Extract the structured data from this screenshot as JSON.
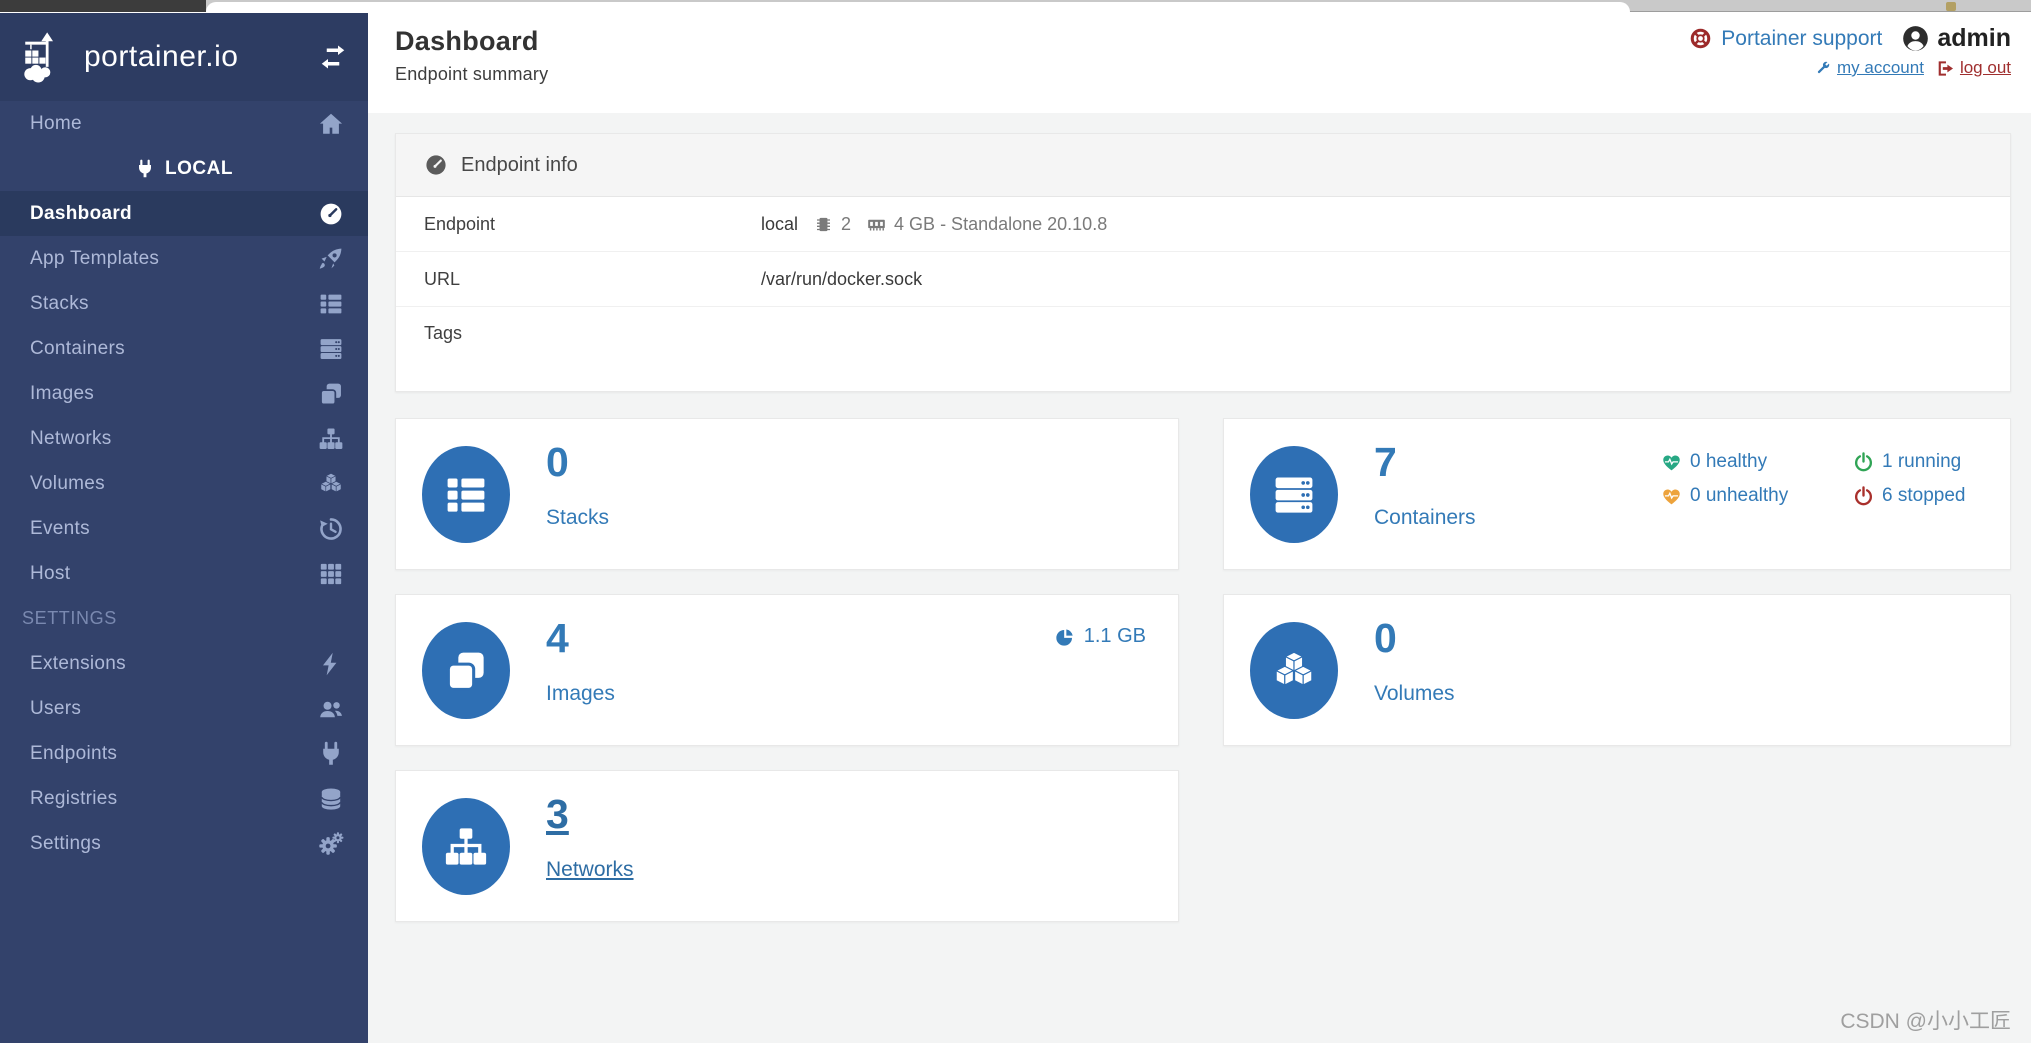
{
  "colors": {
    "accent_blue": "#337ab7",
    "badge_circle_blue": "#2e6fb4",
    "sidebar_bg": "#33426b",
    "sidebar_logo_bg": "#2d3c62",
    "sidebar_active_bg": "#2a3a5e",
    "healthy_green": "#27a884",
    "running_green": "#30a455",
    "unhealthy_orange": "#eda33c",
    "stopped_red": "#a9302c",
    "support_red": "#9c2a2a",
    "content_bg": "#f3f4f4"
  },
  "chrome": {
    "watermark": "CSDN @小小工匠"
  },
  "brand": {
    "name": "portainer.io"
  },
  "sidebar": {
    "home_label": "Home",
    "group_label": "LOCAL",
    "items": [
      {
        "label": "Dashboard",
        "icon": "gauge-icon",
        "active": true
      },
      {
        "label": "App Templates",
        "icon": "rocket-icon"
      },
      {
        "label": "Stacks",
        "icon": "list-icon"
      },
      {
        "label": "Containers",
        "icon": "server-icon"
      },
      {
        "label": "Images",
        "icon": "clone-icon"
      },
      {
        "label": "Networks",
        "icon": "sitemap-icon"
      },
      {
        "label": "Volumes",
        "icon": "cubes-icon"
      },
      {
        "label": "Events",
        "icon": "history-icon"
      },
      {
        "label": "Host",
        "icon": "grid-icon"
      }
    ],
    "settings_label": "SETTINGS",
    "settings_items": [
      {
        "label": "Extensions",
        "icon": "bolt-icon"
      },
      {
        "label": "Users",
        "icon": "users-icon"
      },
      {
        "label": "Endpoints",
        "icon": "plug-icon"
      },
      {
        "label": "Registries",
        "icon": "database-icon"
      },
      {
        "label": "Settings",
        "icon": "cogs-icon"
      }
    ]
  },
  "header": {
    "title": "Dashboard",
    "subtitle": "Endpoint summary",
    "support_label": "Portainer support",
    "username": "admin",
    "my_account_label": "my account",
    "logout_label": "log out"
  },
  "endpoint_info": {
    "title": "Endpoint info",
    "endpoint_label": "Endpoint",
    "endpoint_name": "local",
    "cpu_count": "2",
    "memory_and_engine": "4 GB - Standalone 20.10.8",
    "url_label": "URL",
    "url_value": "/var/run/docker.sock",
    "tags_label": "Tags",
    "tags_value": ""
  },
  "cards": {
    "stacks": {
      "value": "0",
      "label": "Stacks"
    },
    "containers": {
      "value": "7",
      "label": "Containers",
      "healthy": "0 healthy",
      "unhealthy": "0 unhealthy",
      "running": "1 running",
      "stopped": "6 stopped"
    },
    "images": {
      "value": "4",
      "label": "Images",
      "size": "1.1 GB"
    },
    "volumes": {
      "value": "0",
      "label": "Volumes"
    },
    "networks": {
      "value": "3",
      "label": "Networks"
    }
  }
}
